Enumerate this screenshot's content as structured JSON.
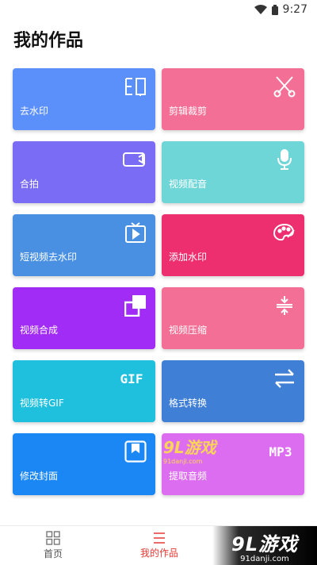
{
  "status_bar": {
    "time": "9:27",
    "icons": [
      "wifi-icon",
      "battery-icon"
    ]
  },
  "page_title": "我的作品",
  "tiles": [
    {
      "label": "去水印",
      "icon": "stamp-icon",
      "color": "#5b8ff9"
    },
    {
      "label": "剪辑裁剪",
      "icon": "scissors-icon",
      "color": "#f36f96"
    },
    {
      "label": "合拍",
      "icon": "camera-icon",
      "color": "#7b6cf6"
    },
    {
      "label": "视频配音",
      "icon": "microphone-icon",
      "color": "#6fd6d8"
    },
    {
      "label": "短视频去水印",
      "icon": "tv-play-icon",
      "color": "#4a90e2"
    },
    {
      "label": "添加水印",
      "icon": "palette-icon",
      "color": "#ee2f6f"
    },
    {
      "label": "视频合成",
      "icon": "layers-icon",
      "color": "#a12cf5"
    },
    {
      "label": "视频压缩",
      "icon": "compress-icon",
      "color": "#f36f96"
    },
    {
      "label": "视频转GIF",
      "icon": "gif-text",
      "icon_text": "GIF",
      "color": "#1fc0de"
    },
    {
      "label": "格式转换",
      "icon": "swap-arrows-icon",
      "color": "#3f7fd6"
    },
    {
      "label": "修改封面",
      "icon": "bookmark-frame-icon",
      "color": "#1b87f4"
    },
    {
      "label": "提取音频",
      "icon": "mp3-text",
      "icon_text": "MP3",
      "color": "#dd6df0"
    }
  ],
  "bottom_nav": [
    {
      "label": "首页",
      "icon": "grid-icon",
      "active": false
    },
    {
      "label": "我的作品",
      "icon": "list-icon",
      "active": true
    }
  ],
  "watermark": {
    "main": "9L游戏",
    "sub": "91danji.com"
  },
  "logo": {
    "main": "9L游戏",
    "sub": "91danji.com"
  },
  "colors": {
    "active": "#e53935",
    "title": "#111111"
  }
}
